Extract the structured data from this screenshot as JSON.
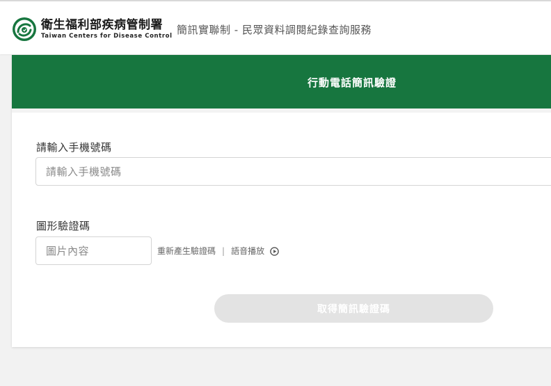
{
  "header": {
    "logo_zh": "衛生福利部疾病管制署",
    "logo_en": "Taiwan Centers for Disease Control",
    "service_title": "簡訊實聯制 - 民眾資料調閱紀錄查詢服務"
  },
  "card": {
    "title": "行動電話簡訊驗證",
    "phone": {
      "label": "請輸入手機號碼",
      "placeholder": "請輸入手機號碼",
      "value": ""
    },
    "captcha": {
      "label": "圖形驗證碼",
      "placeholder": "圖片內容",
      "value": "",
      "regenerate_label": "重新產生驗證碼",
      "separator": "|",
      "audio_label": "語音播放"
    },
    "submit_label": "取得簡訊驗證碼"
  },
  "colors": {
    "brand_green": "#17763f",
    "button_disabled": "#e3e3e3"
  },
  "icons": {
    "logo": "cdc-logo-icon",
    "audio": "play-circle-icon"
  }
}
